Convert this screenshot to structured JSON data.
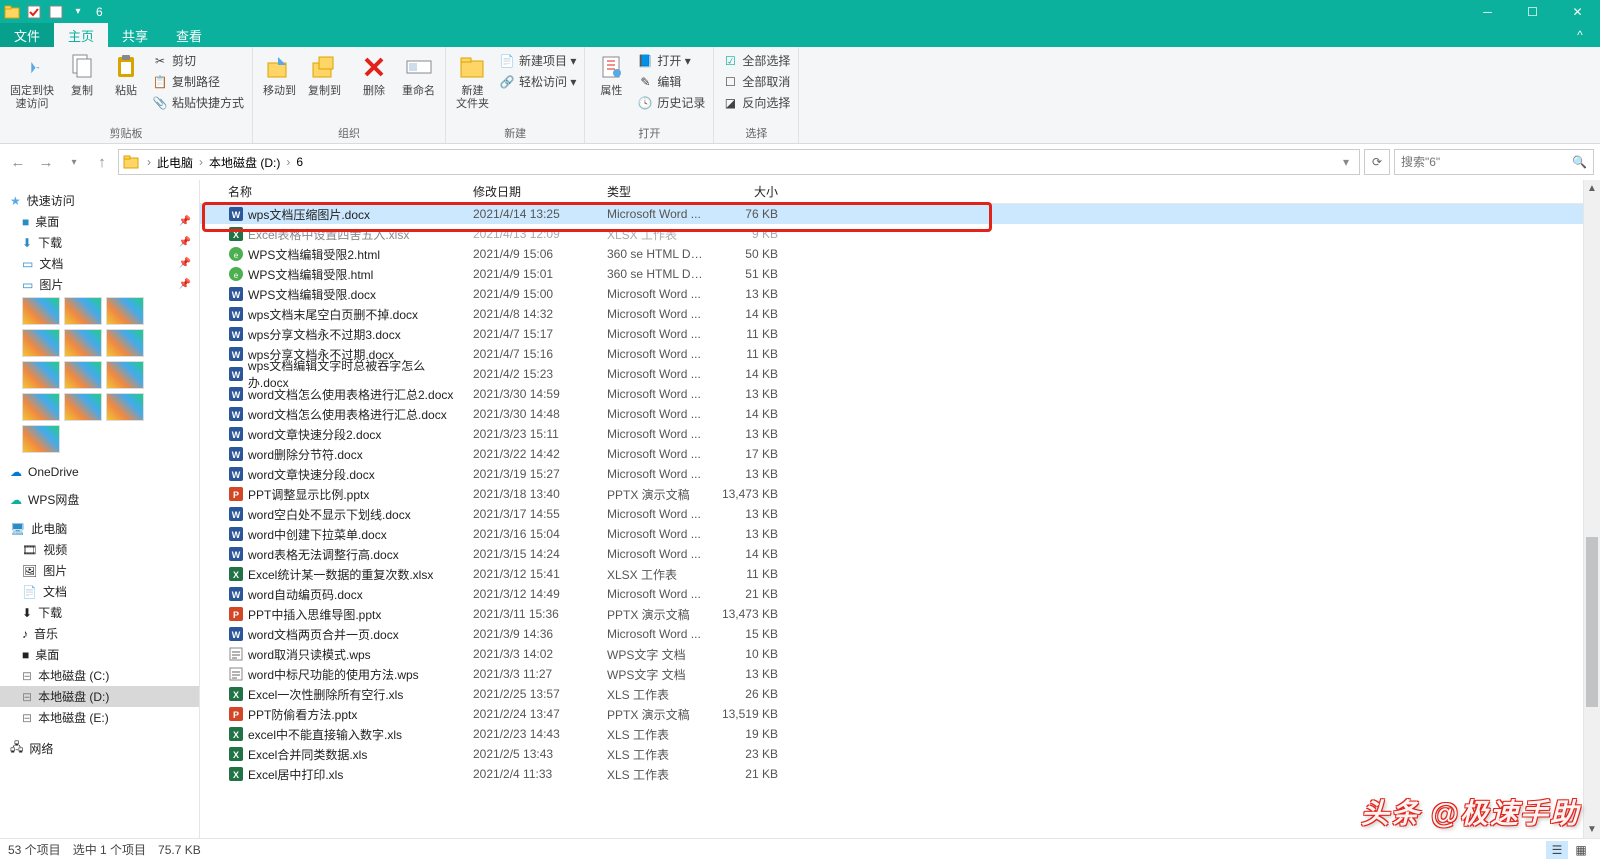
{
  "titlebar": {
    "title": "6"
  },
  "tabs": {
    "file": "文件",
    "home": "主页",
    "share": "共享",
    "view": "查看"
  },
  "ribbon": {
    "clipboard": {
      "pin": "固定到快\n速访问",
      "copy": "复制",
      "paste": "粘贴",
      "cut": "剪切",
      "copypath": "复制路径",
      "pasteshortcut": "粘贴快捷方式",
      "label": "剪贴板"
    },
    "organize": {
      "moveto": "移动到",
      "copyto": "复制到",
      "delete": "删除",
      "rename": "重命名",
      "label": "组织"
    },
    "new": {
      "newfolder": "新建\n文件夹",
      "newitem": "新建项目 ▾",
      "easyaccess": "轻松访问 ▾",
      "label": "新建"
    },
    "open": {
      "properties": "属性",
      "open": "打开 ▾",
      "edit": "编辑",
      "history": "历史记录",
      "label": "打开"
    },
    "select": {
      "selectall": "全部选择",
      "selectnone": "全部取消",
      "invert": "反向选择",
      "label": "选择"
    }
  },
  "address": {
    "thispc": "此电脑",
    "drive": "本地磁盘 (D:)",
    "folder": "6"
  },
  "search": {
    "placeholder": "搜索\"6\""
  },
  "nav": {
    "quickaccess": "快速访问",
    "desktop": "桌面",
    "downloads": "下载",
    "documents": "文档",
    "pictures": "图片",
    "onedrive": "OneDrive",
    "wps": "WPS网盘",
    "thispc": "此电脑",
    "videos": "视频",
    "pictures2": "图片",
    "documents2": "文档",
    "downloads2": "下载",
    "music": "音乐",
    "desktop2": "桌面",
    "drivec": "本地磁盘 (C:)",
    "drived": "本地磁盘 (D:)",
    "drivee": "本地磁盘 (E:)",
    "network": "网络"
  },
  "columns": {
    "name": "名称",
    "date": "修改日期",
    "type": "类型",
    "size": "大小"
  },
  "files": [
    {
      "name": "wps文档压缩图片.docx",
      "date": "2021/4/14 13:25",
      "type": "Microsoft Word ...",
      "size": "76 KB",
      "icon": "word",
      "sel": true
    },
    {
      "name": "Excel表格中设置四舍五入.xlsx",
      "date": "2021/4/13 12:09",
      "type": "XLSX 工作表",
      "size": "9 KB",
      "icon": "excel",
      "dim": true
    },
    {
      "name": "WPS文档编辑受限2.html",
      "date": "2021/4/9 15:06",
      "type": "360 se HTML Do...",
      "size": "50 KB",
      "icon": "html"
    },
    {
      "name": "WPS文档编辑受限.html",
      "date": "2021/4/9 15:01",
      "type": "360 se HTML Do...",
      "size": "51 KB",
      "icon": "html"
    },
    {
      "name": "WPS文档编辑受限.docx",
      "date": "2021/4/9 15:00",
      "type": "Microsoft Word ...",
      "size": "13 KB",
      "icon": "word"
    },
    {
      "name": "wps文档末尾空白页删不掉.docx",
      "date": "2021/4/8 14:32",
      "type": "Microsoft Word ...",
      "size": "14 KB",
      "icon": "word"
    },
    {
      "name": "wps分享文档永不过期3.docx",
      "date": "2021/4/7 15:17",
      "type": "Microsoft Word ...",
      "size": "11 KB",
      "icon": "word"
    },
    {
      "name": "wps分享文档永不过期.docx",
      "date": "2021/4/7 15:16",
      "type": "Microsoft Word ...",
      "size": "11 KB",
      "icon": "word"
    },
    {
      "name": "wps文档编辑文字时总被吞字怎么办.docx",
      "date": "2021/4/2 15:23",
      "type": "Microsoft Word ...",
      "size": "14 KB",
      "icon": "word"
    },
    {
      "name": "word文档怎么使用表格进行汇总2.docx",
      "date": "2021/3/30 14:59",
      "type": "Microsoft Word ...",
      "size": "13 KB",
      "icon": "word"
    },
    {
      "name": "word文档怎么使用表格进行汇总.docx",
      "date": "2021/3/30 14:48",
      "type": "Microsoft Word ...",
      "size": "14 KB",
      "icon": "word"
    },
    {
      "name": "word文章快速分段2.docx",
      "date": "2021/3/23 15:11",
      "type": "Microsoft Word ...",
      "size": "13 KB",
      "icon": "word"
    },
    {
      "name": "word删除分节符.docx",
      "date": "2021/3/22 14:42",
      "type": "Microsoft Word ...",
      "size": "17 KB",
      "icon": "word"
    },
    {
      "name": "word文章快速分段.docx",
      "date": "2021/3/19 15:27",
      "type": "Microsoft Word ...",
      "size": "13 KB",
      "icon": "word"
    },
    {
      "name": "PPT调整显示比例.pptx",
      "date": "2021/3/18 13:40",
      "type": "PPTX 演示文稿",
      "size": "13,473 KB",
      "icon": "ppt"
    },
    {
      "name": "word空白处不显示下划线.docx",
      "date": "2021/3/17 14:55",
      "type": "Microsoft Word ...",
      "size": "13 KB",
      "icon": "word"
    },
    {
      "name": "word中创建下拉菜单.docx",
      "date": "2021/3/16 15:04",
      "type": "Microsoft Word ...",
      "size": "13 KB",
      "icon": "word"
    },
    {
      "name": "word表格无法调整行高.docx",
      "date": "2021/3/15 14:24",
      "type": "Microsoft Word ...",
      "size": "14 KB",
      "icon": "word"
    },
    {
      "name": "Excel统计某一数据的重复次数.xlsx",
      "date": "2021/3/12 15:41",
      "type": "XLSX 工作表",
      "size": "11 KB",
      "icon": "excel"
    },
    {
      "name": "word自动编页码.docx",
      "date": "2021/3/12 14:49",
      "type": "Microsoft Word ...",
      "size": "21 KB",
      "icon": "word"
    },
    {
      "name": "PPT中插入思维导图.pptx",
      "date": "2021/3/11 15:36",
      "type": "PPTX 演示文稿",
      "size": "13,473 KB",
      "icon": "ppt"
    },
    {
      "name": "word文档两页合并一页.docx",
      "date": "2021/3/9 14:36",
      "type": "Microsoft Word ...",
      "size": "15 KB",
      "icon": "word"
    },
    {
      "name": "word取消只读模式.wps",
      "date": "2021/3/3 14:02",
      "type": "WPS文字 文档",
      "size": "10 KB",
      "icon": "wps"
    },
    {
      "name": "word中标尺功能的使用方法.wps",
      "date": "2021/3/3 11:27",
      "type": "WPS文字 文档",
      "size": "13 KB",
      "icon": "wps"
    },
    {
      "name": "Excel一次性删除所有空行.xls",
      "date": "2021/2/25 13:57",
      "type": "XLS 工作表",
      "size": "26 KB",
      "icon": "excel"
    },
    {
      "name": "PPT防偷看方法.pptx",
      "date": "2021/2/24 13:47",
      "type": "PPTX 演示文稿",
      "size": "13,519 KB",
      "icon": "ppt"
    },
    {
      "name": "excel中不能直接输入数字.xls",
      "date": "2021/2/23 14:43",
      "type": "XLS 工作表",
      "size": "19 KB",
      "icon": "excel"
    },
    {
      "name": "Excel合并同类数据.xls",
      "date": "2021/2/5 13:43",
      "type": "XLS 工作表",
      "size": "23 KB",
      "icon": "excel"
    },
    {
      "name": "Excel居中打印.xls",
      "date": "2021/2/4 11:33",
      "type": "XLS 工作表",
      "size": "21 KB",
      "icon": "excel"
    }
  ],
  "status": {
    "count": "53 个项目",
    "selected": "选中 1 个项目",
    "size": "75.7 KB"
  },
  "watermark": "头条 @极速手助"
}
